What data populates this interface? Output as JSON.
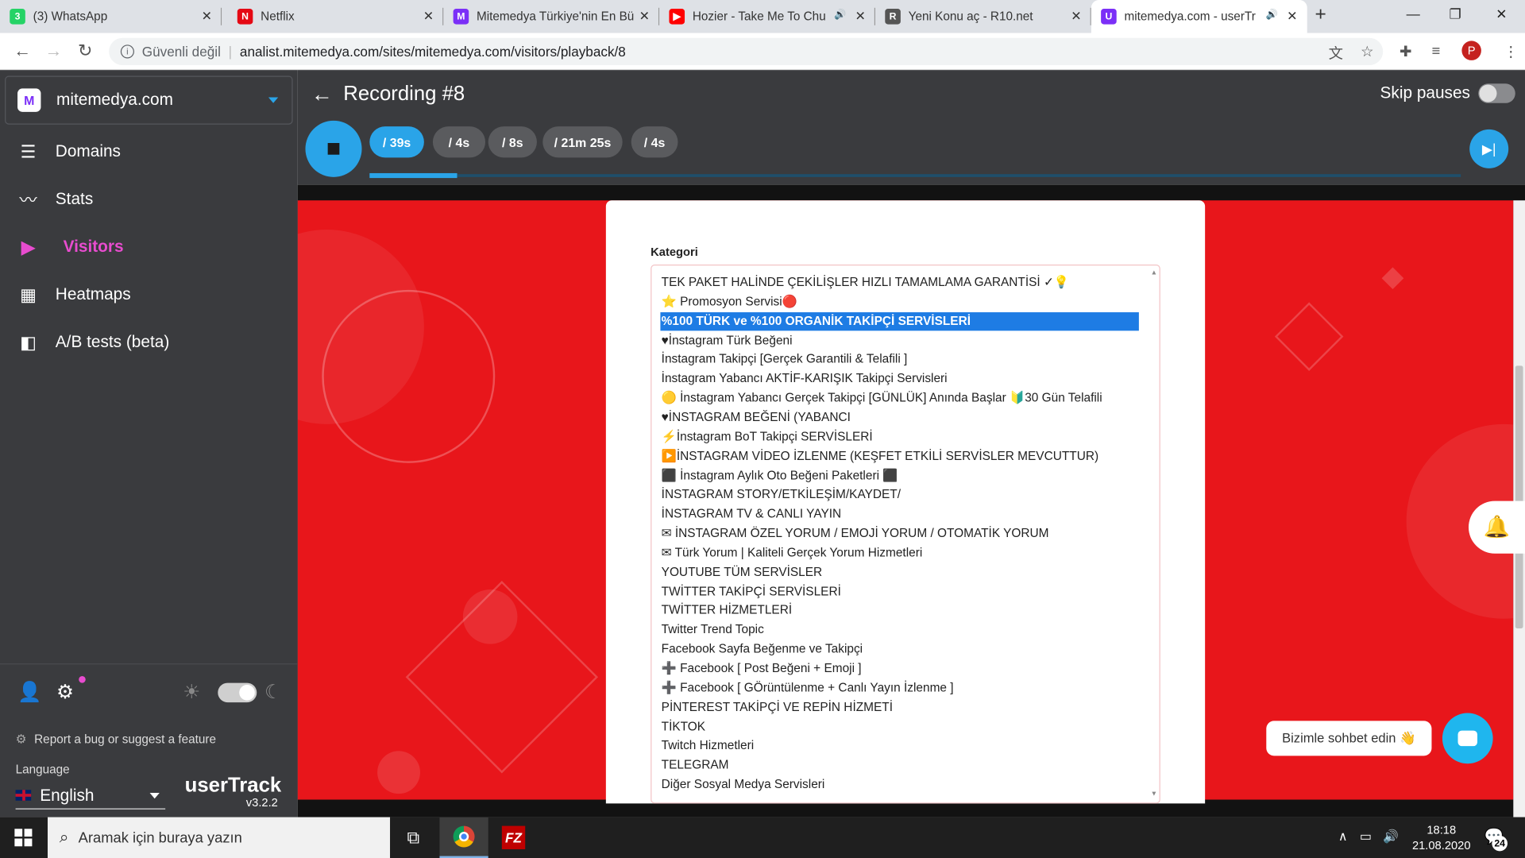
{
  "browser": {
    "tabs": [
      {
        "title": "(3) WhatsApp",
        "fav": "whatsapp-icon",
        "favColor": "#25d366",
        "favText": "3"
      },
      {
        "title": "Netflix",
        "fav": "netflix-icon",
        "favColor": "#e50914",
        "favText": "N"
      },
      {
        "title": "Mitemedya Türkiye'nin En Bü",
        "fav": "mitemedya-icon",
        "favColor": "#7b2ff7",
        "favText": "M"
      },
      {
        "title": "Hozier - Take Me To Chu",
        "fav": "youtube-icon",
        "favColor": "#ff0000",
        "favText": "▶"
      },
      {
        "title": "Yeni Konu aç - R10.net",
        "fav": "r10-icon",
        "favColor": "#555555",
        "favText": "R"
      },
      {
        "title": "mitemedya.com - userTr",
        "fav": "usertrack-icon",
        "favColor": "#7b2ff7",
        "favText": "U"
      }
    ],
    "address": {
      "security": "Güvenli değil",
      "url": "analist.mitemedya.com/sites/mitemedya.com/visitors/playback/8"
    }
  },
  "sidebar": {
    "site": "mitemedya.com",
    "items": [
      {
        "label": "Domains",
        "icon": "list-icon",
        "glyph": "☰"
      },
      {
        "label": "Stats",
        "icon": "trend-icon",
        "glyph": "〰"
      },
      {
        "label": "Visitors",
        "icon": "tv-icon",
        "glyph": "▶"
      },
      {
        "label": "Heatmaps",
        "icon": "heatmap-icon",
        "glyph": "▦"
      },
      {
        "label": "A/B tests (beta)",
        "icon": "ab-icon",
        "glyph": "◧"
      }
    ],
    "report": "Report a bug or suggest a feature",
    "language_label": "Language",
    "language": "English",
    "brand": "userTrack",
    "version": "v3.2.2"
  },
  "player": {
    "title": "Recording #8",
    "skip_label": "Skip pauses",
    "segments": [
      "/ 39s",
      "/ 4s",
      "/ 8s",
      "/ 21m 25s",
      "/ 4s"
    ],
    "progress": 0.08
  },
  "page": {
    "category_label": "Kategori",
    "options": [
      "TEK PAKET HALİNDE ÇEKİLİŞLER HIZLI TAMAMLAMA GARANTİSİ ✓💡",
      "⭐ Promosyon Servisi🔴",
      "%100 TÜRK ve %100 ORGANİK TAKİPÇİ SERVİSLERİ",
      "♥İnstagram Türk Beğeni",
      "İnstagram Takipçi [Gerçek Garantili & Telafili ]",
      "İnstagram Yabancı AKTİF-KARIŞIK Takipçi Servisleri",
      "🟡 İnstagram Yabancı Gerçek Takipçi [GÜNLÜK] Anında Başlar 🔰30 Gün Telafili",
      "♥İNSTAGRAM BEĞENİ (YABANCI",
      "⚡İnstagram BoT Takipçi SERVİSLERİ",
      "▶️İNSTAGRAM VİDEO İZLENME (KEŞFET ETKİLİ SERVİSLER MEVCUTTUR)",
      "⬛ İnstagram Aylık Oto Beğeni Paketleri ⬛",
      "İNSTAGRAM STORY/ETKİLEŞİM/KAYDET/",
      "İNSTAGRAM TV & CANLI YAYIN",
      "✉ İNSTAGRAM ÖZEL YORUM / EMOJİ YORUM / OTOMATİK YORUM",
      "✉ Türk Yorum | Kaliteli Gerçek Yorum Hizmetleri",
      "YOUTUBE TÜM SERVİSLER",
      "TWİTTER TAKİPÇİ SERVİSLERİ",
      "TWİTTER HİZMETLERİ",
      "Twitter Trend Topic",
      "Facebook Sayfa Beğenme ve Takipçi",
      "➕ Facebook [ Post Beğeni + Emoji ]",
      "➕ Facebook [ GÖrüntülenme + Canlı Yayın İzlenme ]",
      "PİNTEREST TAKİPÇİ VE REPİN HİZMETİ",
      "TİKTOK",
      "Twitch Hizmetleri",
      "TELEGRAM",
      "Diğer Sosyal Medya Servisleri"
    ],
    "selected_index": 2,
    "chat_label": "Bizimle sohbet edin 👋"
  },
  "taskbar": {
    "search_placeholder": "Aramak için buraya yazın",
    "time": "18:18",
    "date": "21.08.2020",
    "notifications": "24"
  },
  "colors": {
    "accent": "#2aa4e8",
    "visitors": "#e84ccf",
    "page_red": "#e8161b",
    "selected_option": "#1e7ce4"
  }
}
